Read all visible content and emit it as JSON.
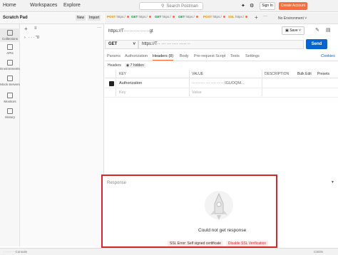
{
  "topbar": {
    "nav": [
      "Home",
      "Workspaces",
      "Explore"
    ],
    "search_placeholder": "Search Postman",
    "sign_in": "Sign In",
    "create_account": "Create Account"
  },
  "sidebar": {
    "workspace_title": "Scratch Pad",
    "new_label": "New",
    "import_label": "Import",
    "rail": [
      "Collections",
      "APIs",
      "Environments",
      "Mock Servers",
      "Monitors",
      "History"
    ],
    "tree_item": "· · · \"0"
  },
  "tabs": [
    {
      "method": "POST",
      "label": "https:/"
    },
    {
      "method": "GET",
      "label": "https:/"
    },
    {
      "method": "GET",
      "label": "https:/"
    },
    {
      "method": "GET",
      "label": "https:/"
    },
    {
      "method": "POST",
      "label": "https:/"
    },
    {
      "method": "SSL",
      "label": "https:/"
    }
  ],
  "environment": "No Environment",
  "request": {
    "breadcrumb": "https://T··················gt",
    "save_label": "Save",
    "method": "GET",
    "url": "https://T·· ··· ··· ···· ····· ··",
    "send_label": "Send",
    "tabs": [
      "Params",
      "Authorization",
      "Headers (8)",
      "Body",
      "Pre-request Script",
      "Tests",
      "Settings"
    ],
    "active_tab": "Headers (8)",
    "cookies_label": "Cookies",
    "headers_sub": [
      "Headers",
      "7 hidden"
    ]
  },
  "headers_table": {
    "columns": [
      "KEY",
      "VALUE",
      "DESCRIPTION",
      "Bulk Edit",
      "Presets"
    ],
    "rows": [
      {
        "key": "Authorization",
        "value": "·········· ··· ···· ·· ·· IGUOQM...",
        "checked": true
      },
      {
        "key": "Key",
        "value": "Value",
        "checked": false
      }
    ]
  },
  "response": {
    "label": "Response",
    "message": "Could not get response",
    "ssl_error": "SSL Error: Self signed certificate",
    "ssl_disable": "Disable SSL Verification"
  },
  "footer": {
    "left": "· · ·   · · ·   Console",
    "right": "CSDN"
  },
  "colors": {
    "accent": "#ff6c37",
    "send": "#0265d2",
    "highlight": "#d9262c"
  }
}
